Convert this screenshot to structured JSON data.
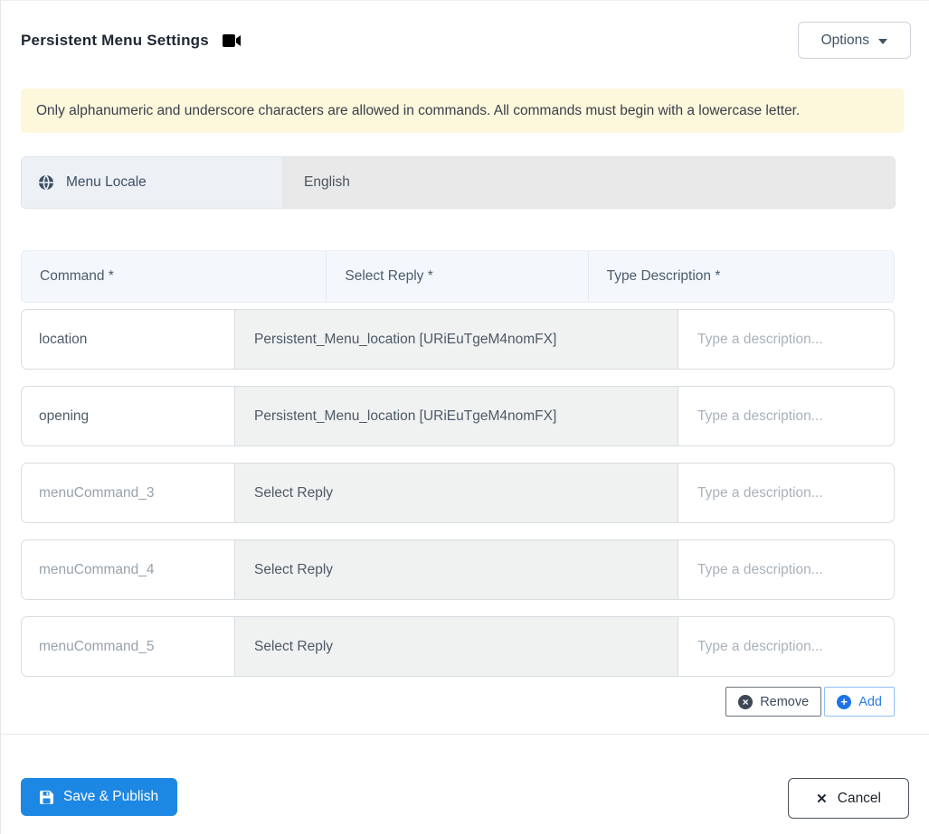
{
  "colors": {
    "primary_blue": "#1d87e4",
    "add_blue": "#2a7de1",
    "remove_dark": "#3d4854",
    "alert_bg": "#fdf7dc",
    "table_header_bg": "#f4f8fd",
    "select_cell_bg": "#f0f1f1",
    "locale_label_bg": "#edf1f6",
    "locale_value_bg": "#e9e9e9"
  },
  "header": {
    "title": "Persistent Menu Settings",
    "title_icon": "video-camera-icon",
    "options_label": "Options"
  },
  "alert": {
    "text": "Only alphanumeric and underscore characters are allowed in commands. All commands must begin with a lowercase letter."
  },
  "locale": {
    "icon": "globe-icon",
    "label": "Menu Locale",
    "value": "English"
  },
  "table": {
    "columns": [
      "Command *",
      "Select Reply *",
      "Type Description *"
    ],
    "rows": [
      {
        "command": "location",
        "command_muted": false,
        "reply": "Persistent_Menu_location [URiEuTgeM4nomFX]",
        "description_placeholder": "Type a description..."
      },
      {
        "command": "opening",
        "command_muted": false,
        "reply": "Persistent_Menu_location [URiEuTgeM4nomFX]",
        "description_placeholder": "Type a description..."
      },
      {
        "command": "menuCommand_3",
        "command_muted": true,
        "reply": "Select Reply",
        "description_placeholder": "Type a description..."
      },
      {
        "command": "menuCommand_4",
        "command_muted": true,
        "reply": "Select Reply",
        "description_placeholder": "Type a description..."
      },
      {
        "command": "menuCommand_5",
        "command_muted": true,
        "reply": "Select Reply",
        "description_placeholder": "Type a description..."
      }
    ],
    "remove_label": "Remove",
    "add_label": "Add"
  },
  "footer": {
    "save_label": "Save & Publish",
    "cancel_label": "Cancel"
  }
}
